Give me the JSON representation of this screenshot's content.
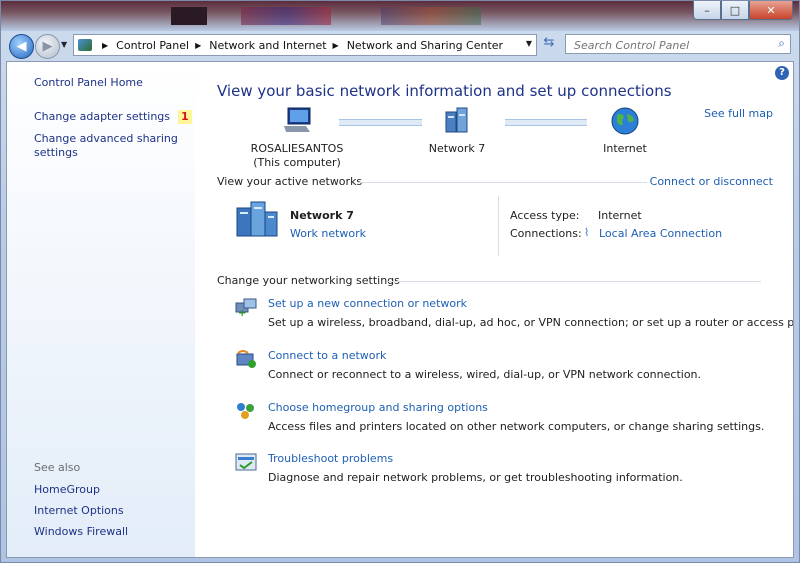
{
  "window": {
    "minimize_label": "–",
    "maximize_label": "□",
    "close_label": "✕"
  },
  "address": {
    "crumbs": [
      "Control Panel",
      "Network and Internet",
      "Network and Sharing Center"
    ],
    "search_placeholder": "Search Control Panel"
  },
  "sidebar": {
    "home": "Control Panel Home",
    "adapter": "Change adapter settings",
    "adapter_badge": "1",
    "advanced_line1": "Change advanced sharing",
    "advanced_line2": "settings",
    "see_also": "See also",
    "see_also_items": [
      "HomeGroup",
      "Internet Options",
      "Windows Firewall"
    ]
  },
  "main": {
    "help": "?",
    "title": "View your basic network information and set up connections",
    "see_full_map": "See full map",
    "map": {
      "computer_name": "ROSALIESANTOS",
      "computer_sub": "(This computer)",
      "network": "Network  7",
      "internet": "Internet"
    },
    "active_header": "View your active networks",
    "connect_disconnect": "Connect or disconnect",
    "active": {
      "name": "Network  7",
      "type": "Work network",
      "access_label": "Access type:",
      "access_value": "Internet",
      "connections_label": "Connections:",
      "connections_value": "Local Area Connection"
    },
    "settings_header": "Change your networking settings",
    "tasks": [
      {
        "link": "Set up a new connection or network",
        "desc": "Set up a wireless, broadband, dial-up, ad hoc, or VPN connection; or set up a router or access point."
      },
      {
        "link": "Connect to a network",
        "desc": "Connect or reconnect to a wireless, wired, dial-up, or VPN network connection."
      },
      {
        "link": "Choose homegroup and sharing options",
        "desc": "Access files and printers located on other network computers, or change sharing settings."
      },
      {
        "link": "Troubleshoot problems",
        "desc": "Diagnose and repair network problems, or get troubleshooting information."
      }
    ]
  },
  "colors": {
    "link": "#1e5fb4",
    "title": "#1e3287",
    "badge_bg": "#fff69a",
    "badge_text": "#d2141b"
  }
}
